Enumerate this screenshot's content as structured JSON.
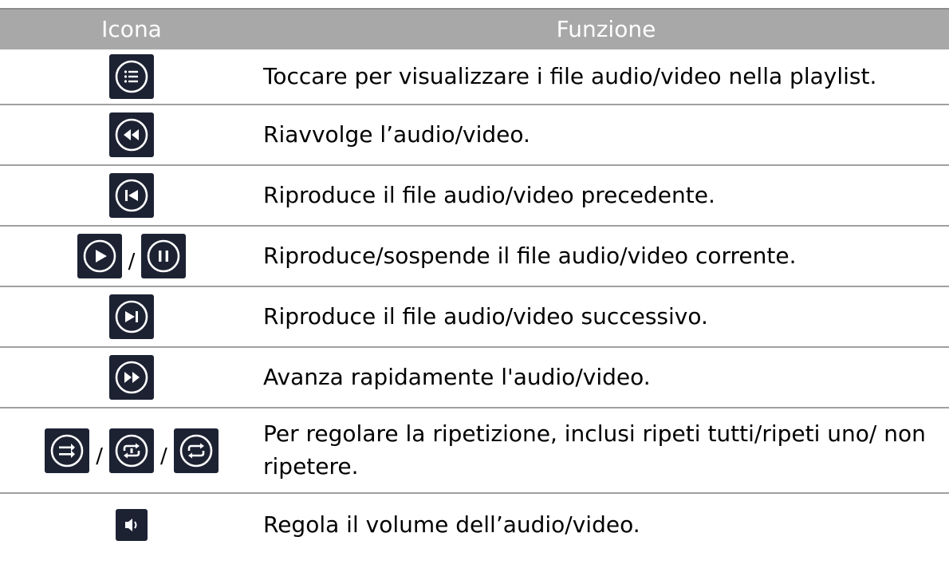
{
  "header": {
    "icon_col": "Icona",
    "function_col": "Funzione"
  },
  "rows": [
    {
      "icons": [
        "playlist-icon"
      ],
      "text": "Toccare per visualizzare i file audio/video nella playlist."
    },
    {
      "icons": [
        "rewind-icon"
      ],
      "text": "Riavvolge l’audio/video."
    },
    {
      "icons": [
        "previous-icon"
      ],
      "text": "Riproduce il file audio/video precedente."
    },
    {
      "icons": [
        "play-icon",
        "pause-icon"
      ],
      "separator": "/",
      "text": "Riproduce/sospende il file audio/video corrente."
    },
    {
      "icons": [
        "next-icon"
      ],
      "text": "Riproduce il file audio/video successivo."
    },
    {
      "icons": [
        "fast-forward-icon"
      ],
      "text": "Avanza rapidamente l'audio/video."
    },
    {
      "icons": [
        "shuffle-icon",
        "repeat-all-icon",
        "repeat-icon"
      ],
      "separator": "/",
      "text": "Per regolare la ripetizione, inclusi ripeti tutti/ripeti uno/ non ripetere."
    },
    {
      "icons": [
        "volume-icon"
      ],
      "text": "Regola il volume dell’audio/video."
    }
  ],
  "colors": {
    "header_bg": "#a8a8a8",
    "icon_bg": "#1d2233",
    "icon_fg": "#ffffff",
    "divider": "#a0a0a0"
  }
}
